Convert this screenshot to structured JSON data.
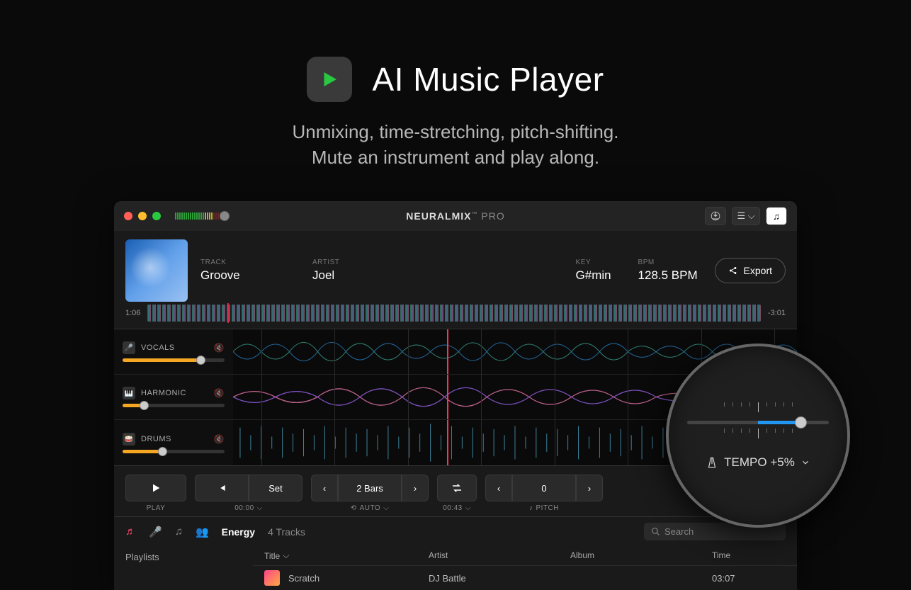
{
  "hero": {
    "title": "AI Music Player",
    "subtitle1": "Unmixing, time-stretching, pitch-shifting.",
    "subtitle2": "Mute an instrument and play along."
  },
  "app": {
    "brand1": "NEURALMIX",
    "brand_tm": "™",
    "brand2": "PRO"
  },
  "track": {
    "track_label": "TRACK",
    "track_value": "Groove",
    "artist_label": "ARTIST",
    "artist_value": "Joel",
    "key_label": "KEY",
    "key_value": "G#min",
    "bpm_label": "BPM",
    "bpm_value": "128.5 BPM",
    "export": "Export",
    "elapsed": "1:06",
    "remaining": "-3:01"
  },
  "stems": [
    {
      "name": "VOCALS",
      "vol": 75
    },
    {
      "name": "HARMONIC",
      "vol": 20
    },
    {
      "name": "DRUMS",
      "vol": 38
    }
  ],
  "transport": {
    "play_label": "PLAY",
    "set": "Set",
    "time": "00:00",
    "bars": "2 Bars",
    "auto": "AUTO",
    "loop_time": "00:43",
    "offset": "0",
    "pitch": "PITCH"
  },
  "browser": {
    "list_title": "Energy",
    "list_count": "4 Tracks",
    "search_placeholder": "Search",
    "col_title": "Title",
    "col_artist": "Artist",
    "col_album": "Album",
    "col_time": "Time",
    "sidebar": "Playlists",
    "row1_title": "Scratch",
    "row1_artist": "DJ Battle",
    "row1_time": "03:07"
  },
  "magnifier": {
    "label": "TEMPO +5%"
  }
}
